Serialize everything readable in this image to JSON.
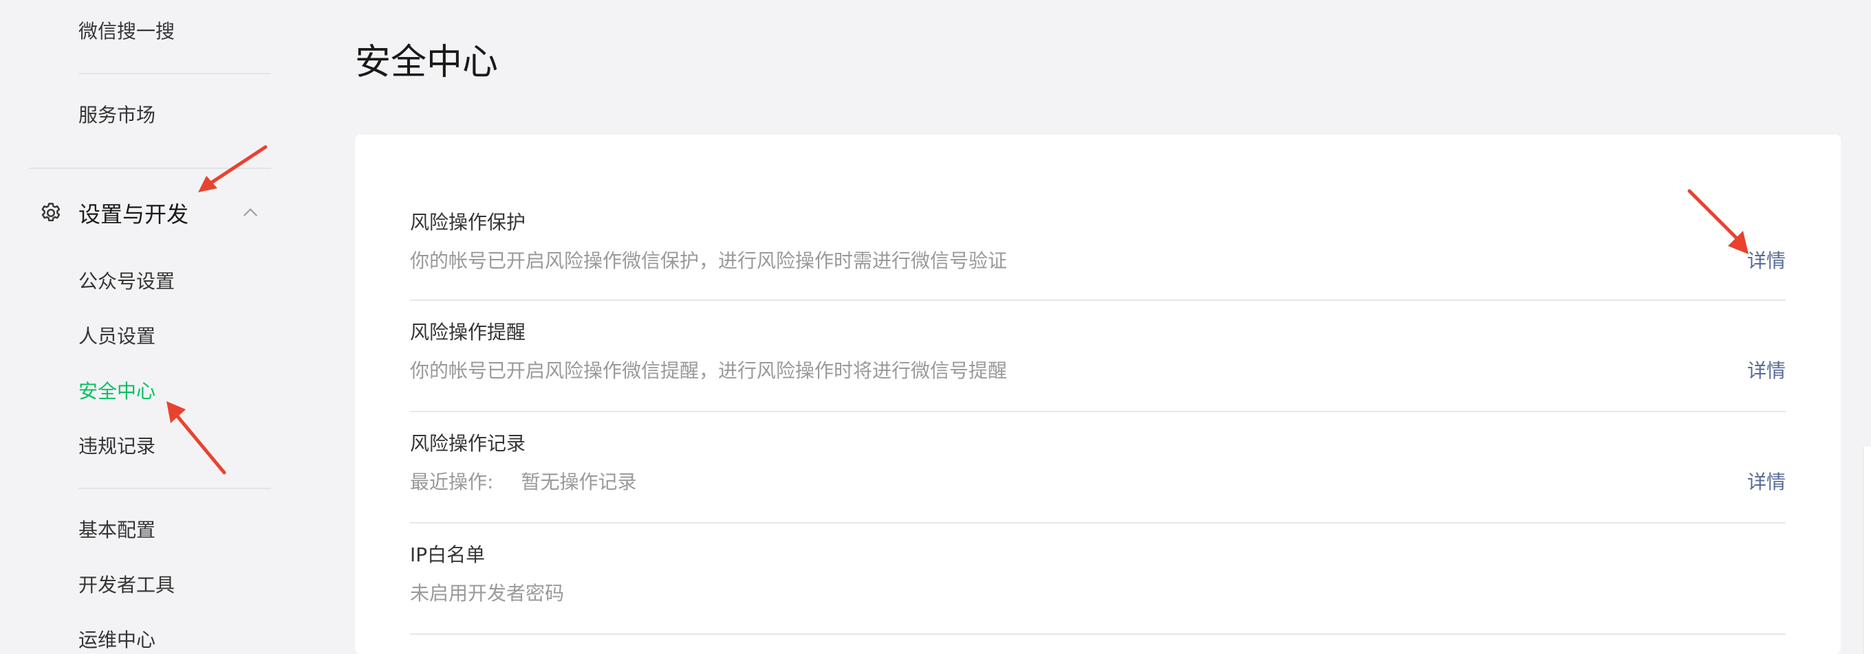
{
  "sidebar": {
    "items_top": [
      {
        "label": "微信搜一搜"
      },
      {
        "label": "服务市场"
      }
    ],
    "section": {
      "title": "设置与开发",
      "icon": "gear-icon",
      "expanded_icon": "chevron-up-icon"
    },
    "section_items": [
      {
        "label": "公众号设置",
        "active": false
      },
      {
        "label": "人员设置",
        "active": false
      },
      {
        "label": "安全中心",
        "active": true
      },
      {
        "label": "违规记录",
        "active": false
      }
    ],
    "items_bottom": [
      {
        "label": "基本配置"
      },
      {
        "label": "开发者工具"
      },
      {
        "label": "运维中心"
      }
    ]
  },
  "main": {
    "title": "安全中心",
    "rows": [
      {
        "title": "风险操作保护",
        "desc": "你的帐号已开启风险操作微信保护，进行风险操作时需进行微信号验证",
        "link": "详情"
      },
      {
        "title": "风险操作提醒",
        "desc": "你的帐号已开启风险操作微信提醒，进行风险操作时将进行微信号提醒",
        "link": "详情"
      },
      {
        "title": "风险操作记录",
        "desc_label": "最近操作:",
        "desc_value": "暂无操作记录",
        "link": "详情"
      },
      {
        "title": "IP白名单",
        "desc": "未启用开发者密码"
      }
    ]
  },
  "colors": {
    "active": "#07c160",
    "link": "#576b95",
    "annotation_arrow": "#e8432f",
    "page_bg": "#f3f3f5"
  }
}
